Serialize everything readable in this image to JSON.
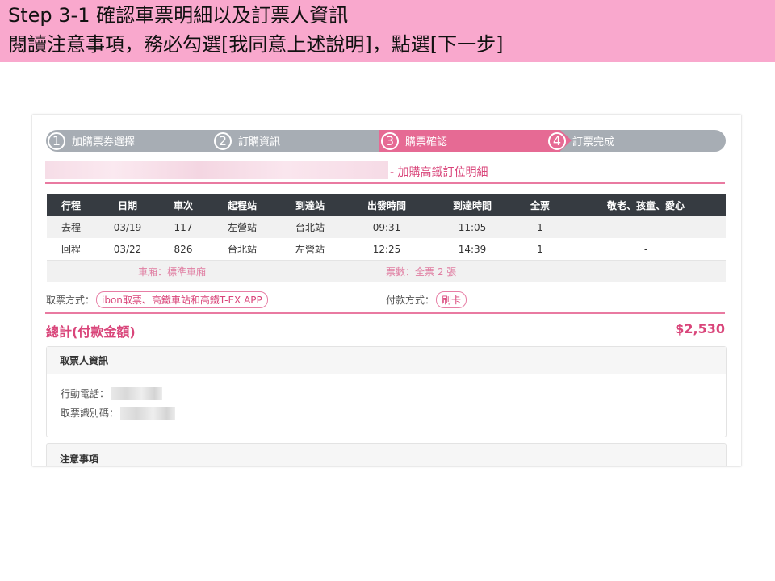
{
  "slide": {
    "line1": "Step 3-1 確認車票明細以及訂票人資訊",
    "line2": "閱讀注意事項，務必勾選[我同意上述說明]，點選[下一步]"
  },
  "steps": [
    {
      "num": "1",
      "label": "加購票券選擇"
    },
    {
      "num": "2",
      "label": "訂購資訊"
    },
    {
      "num": "3",
      "label": "購票確認"
    },
    {
      "num": "4",
      "label": "訂票完成"
    }
  ],
  "section_title": "- 加購高鐵訂位明細",
  "table": {
    "headers": [
      "行程",
      "日期",
      "車次",
      "起程站",
      "到達站",
      "出發時間",
      "到達時間",
      "全票",
      "敬老、孩童、愛心"
    ],
    "rows": [
      [
        "去程",
        "03/19",
        "117",
        "左營站",
        "台北站",
        "09:31",
        "11:05",
        "1",
        "-"
      ],
      [
        "回程",
        "03/22",
        "826",
        "台北站",
        "左營站",
        "12:25",
        "14:39",
        "1",
        "-"
      ]
    ],
    "summary_car": "車廂：標準車廂",
    "summary_tickets": "票數：全票 2 張"
  },
  "pickup": {
    "label": "取票方式：",
    "value": "ibon取票、高鐵車站和高鐵T-EX APP"
  },
  "payment": {
    "label": "付款方式：",
    "value": "刷卡"
  },
  "total": {
    "label": "總計(付款金額)",
    "amount": "$2,530"
  },
  "ticket_holder": {
    "title": "取票人資訊",
    "phone_label": "行動電話：",
    "id_label": "取票識別碼："
  },
  "notice": {
    "title": "注意事項"
  },
  "colors": {
    "accent": "#e66a94",
    "header_bg": "#f9a8cd",
    "table_head": "#363b41"
  }
}
